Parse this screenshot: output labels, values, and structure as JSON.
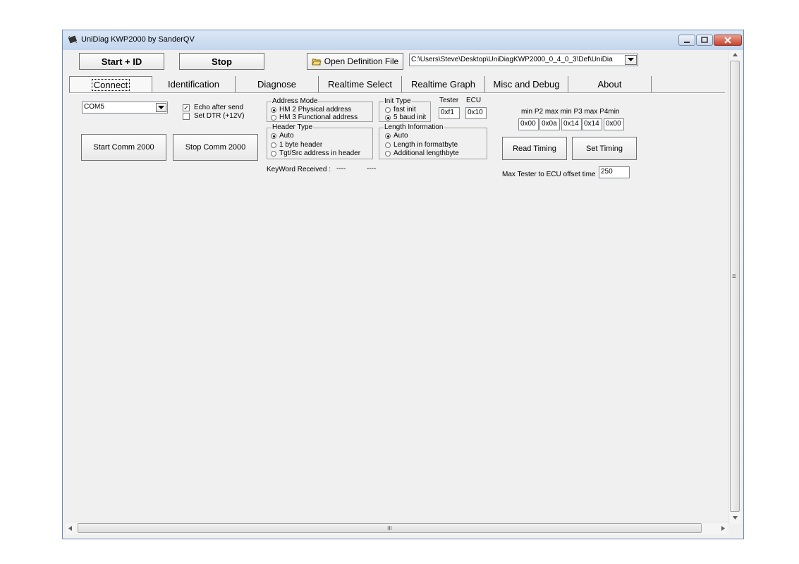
{
  "window": {
    "title": "UniDiag KWP2000 by SanderQV"
  },
  "toolbar": {
    "start_label": "Start + ID",
    "stop_label": "Stop",
    "open_def_label": "Open Definition File",
    "def_path": "C:\\Users\\Steve\\Desktop\\UniDiagKWP2000_0_4_0_3\\Def\\UniDia"
  },
  "tabs": [
    {
      "label": "Connect",
      "active": true
    },
    {
      "label": "Identification"
    },
    {
      "label": "Diagnose"
    },
    {
      "label": "Realtime Select"
    },
    {
      "label": "Realtime Graph"
    },
    {
      "label": "Misc and Debug"
    },
    {
      "label": "About"
    }
  ],
  "connect": {
    "com_port": "COM5",
    "echo_label": "Echo after send",
    "echo_checked": true,
    "dtr_label": "Set DTR (+12V)",
    "dtr_checked": false,
    "start_comm_label": "Start Comm 2000",
    "stop_comm_label": "Stop  Comm 2000",
    "address_mode": {
      "legend": "Address Mode",
      "options": [
        "HM 2 Physical address",
        "HM 3 Functional address"
      ],
      "selected": 0
    },
    "header_type": {
      "legend": "Header Type",
      "options": [
        "Auto",
        "1 byte  header",
        "Tgt/Src address in header"
      ],
      "selected": 0
    },
    "init_type": {
      "legend": "Init Type",
      "options": [
        "fast init",
        "5 baud init"
      ],
      "selected": 1
    },
    "length_info": {
      "legend": "Length Information",
      "options": [
        "Auto",
        "Length in formatbyte",
        "Additional lengthbyte"
      ],
      "selected": 0
    },
    "tester_label": "Tester",
    "ecu_label": "ECU",
    "tester_value": "0xf1",
    "ecu_value": "0x10",
    "keyword_label": "KeyWord Received :",
    "keyword_value_1": "----",
    "keyword_value_2": "----",
    "timing_header": "min P2 max  min P3 max  P4min",
    "timing_values": [
      "0x00",
      "0x0a",
      "0x14",
      "0x14",
      "0x00"
    ],
    "read_timing_label": "Read Timing",
    "set_timing_label": "Set Timing",
    "offset_label": "Max Tester to ECU offset time",
    "offset_value": "250"
  },
  "scroll": {
    "hscroll_grip": "III",
    "vscroll_grip": "≡"
  },
  "colors": {
    "titlebar": "#c3d6ee",
    "window_bg": "#f0f0f0",
    "close_button": "#c7432d"
  },
  "icons": [
    "app-chip-icon",
    "minimize-icon",
    "maximize-icon",
    "close-icon",
    "folder-open-icon",
    "chevron-down-icon",
    "scroll-up-icon",
    "scroll-down-icon",
    "scroll-left-icon",
    "scroll-right-icon"
  ]
}
